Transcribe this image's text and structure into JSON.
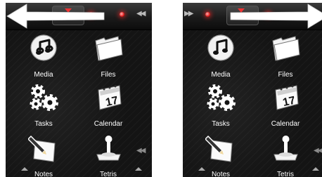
{
  "left_screen": {
    "apps": [
      {
        "label": "Media",
        "icon": "music-note-icon"
      },
      {
        "label": "Files",
        "icon": "folder-icon"
      },
      {
        "label": "Tasks",
        "icon": "gears-icon"
      },
      {
        "label": "Calendar",
        "icon": "calendar-icon"
      },
      {
        "label": "Notes",
        "icon": "pencil-notepad-icon"
      },
      {
        "label": "Tetris",
        "icon": "joystick-icon"
      }
    ],
    "scroll_arrow": "left"
  },
  "right_screen": {
    "apps": [
      {
        "label": "Media",
        "icon": "music-note-icon"
      },
      {
        "label": "Files",
        "icon": "folder-icon"
      },
      {
        "label": "Tasks",
        "icon": "gears-icon"
      },
      {
        "label": "Calendar",
        "icon": "calendar-icon"
      },
      {
        "label": "Notes",
        "icon": "pencil-notepad-icon"
      },
      {
        "label": "Tetris",
        "icon": "joystick-icon"
      }
    ],
    "scroll_arrow": "right"
  },
  "colors": {
    "background": "#141414",
    "led": "#e01b1b",
    "arrow": "#ffffff",
    "label": "#ffffff"
  }
}
